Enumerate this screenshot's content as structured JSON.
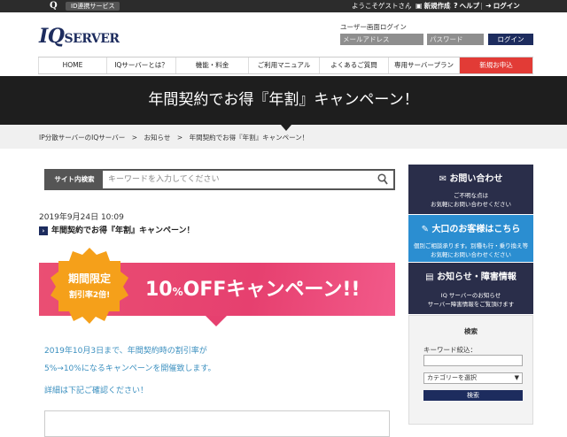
{
  "topbar": {
    "logo_letter": "Q",
    "id_service": "ID連携サービス",
    "welcome": "ようこそゲストさん",
    "new_account": "新規作成",
    "help": "ヘルプ",
    "login": "ログイン"
  },
  "header": {
    "logo_big": "IQ",
    "logo_small": "SERVER",
    "login_label": "ユーザー画面ログイン",
    "email_placeholder": "メールアドレス",
    "password_placeholder": "パスワード",
    "login_button": "ログイン"
  },
  "nav": {
    "items": [
      {
        "label": "HOME"
      },
      {
        "label": "IQサーバーとは？"
      },
      {
        "label": "機能・料金"
      },
      {
        "label": "ご利用マニュアル"
      },
      {
        "label": "よくあるご質問"
      },
      {
        "label": "専用サーバープラン"
      },
      {
        "label": "新規お申込"
      }
    ]
  },
  "hero": {
    "title": "年間契約でお得『年割』キャンペーン！"
  },
  "breadcrumb": {
    "text": "IP分散サーバーのIQサーバー　>　お知らせ　>　年間契約でお得『年割』キャンペーン！"
  },
  "search": {
    "label": "サイト内検索",
    "placeholder": "キーワードを入力してください"
  },
  "post": {
    "date": "2019年9月24日 10:09",
    "title": "年間契約でお得『年割』キャンペーン！"
  },
  "banner": {
    "badge_line1": "期間限定",
    "badge_line2": "割引率2倍!",
    "headline_num": "10",
    "headline_pct": "%",
    "headline_rest": "OFFキャンペーン!!"
  },
  "content": {
    "line1": "2019年10月3日まで、年間契約時の割引率が",
    "line2": "5%→10%になるキャンペーンを開催致します。",
    "line3": "詳細は下記ご確認ください！"
  },
  "sidebar": {
    "contact_title": "お問い合わせ",
    "contact_sub1": "ご不明な点は",
    "contact_sub2": "お気軽にお問い合わせください",
    "bulk_title": "大口のお客様はこちら",
    "bulk_sub1": "個別ご相談承ります。別種も行・乗り換え等",
    "bulk_sub2": "お気軽にお問い合わせください",
    "news_title": "お知らせ・障害情報",
    "news_sub1": "IQ サーバーのお知らせ",
    "news_sub2": "サーバー障害情報をご覧頂けます",
    "search_title": "検索",
    "keyword_label": "キーワード絞込：",
    "category_select": "カテゴリーを選択",
    "search_button": "検索"
  },
  "colors": {
    "navy": "#1d2c5e",
    "red": "#e23b36",
    "pink": "#e6406f",
    "blue": "#2b8ed1",
    "orange": "#f5a01a"
  }
}
